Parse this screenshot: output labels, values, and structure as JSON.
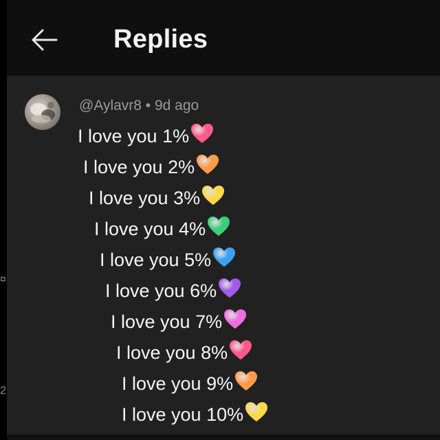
{
  "header": {
    "back_icon": "arrow-left-icon",
    "title": "Replies"
  },
  "comment": {
    "avatar_icon": "user-avatar",
    "meta": "@Aylavr8 • 9d ago",
    "lines": [
      {
        "text": "I love you 1%",
        "heart": "#ff5a8a"
      },
      {
        "text": "I love you 2%",
        "heart": "#ff9a4a"
      },
      {
        "text": "I love you 3%",
        "heart": "#ffd84a"
      },
      {
        "text": "I love you 4%",
        "heart": "#3ccf7a"
      },
      {
        "text": "I love you 5%",
        "heart": "#3aa2f2"
      },
      {
        "text": "I love you 6%",
        "heart": "#a35ae8"
      },
      {
        "text": "I love you 7%",
        "heart": "#ee6ee0"
      },
      {
        "text": "I love you 8%",
        "heart": "#ff5a8a"
      },
      {
        "text": "I love you 9%",
        "heart": "#ff9a4a"
      },
      {
        "text": "I love you 10%",
        "heart": "#ffd84a"
      }
    ]
  }
}
